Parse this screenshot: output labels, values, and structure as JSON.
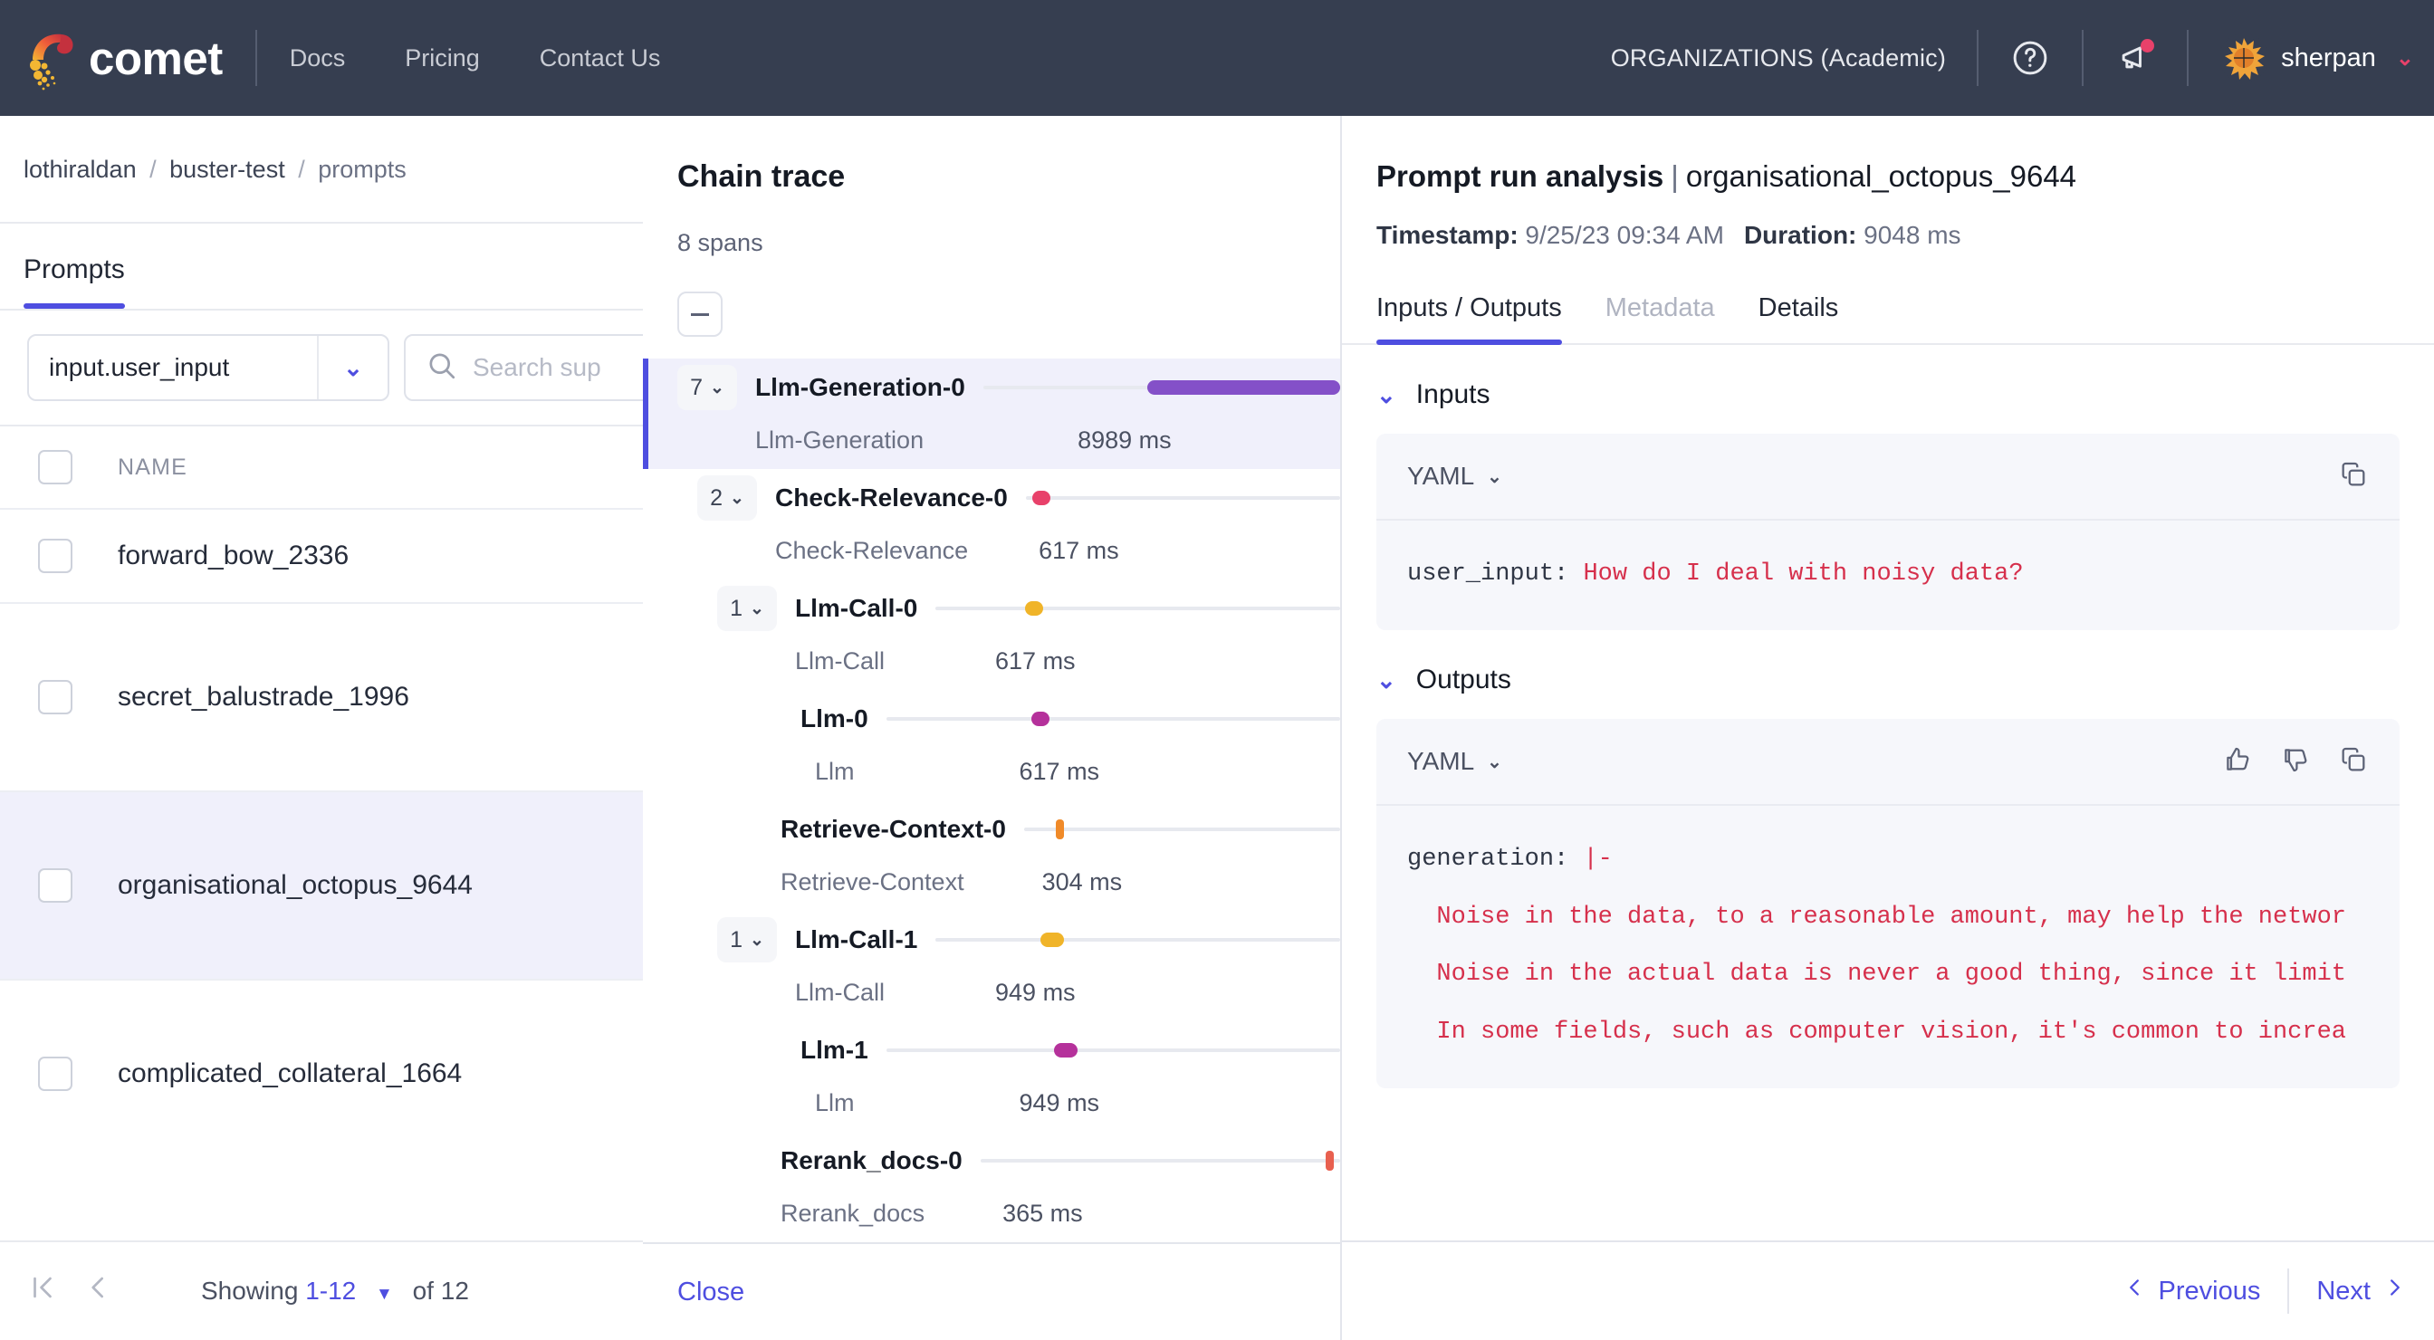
{
  "topnav": {
    "brand": "comet",
    "links": [
      {
        "label": "Docs"
      },
      {
        "label": "Pricing"
      },
      {
        "label": "Contact Us"
      }
    ],
    "organizations": "ORGANIZATIONS (Academic)",
    "help_icon": "question-circle-icon",
    "announcements_icon": "megaphone-icon",
    "username": "sherpan",
    "user_caret": "⌄",
    "colors": {
      "bar": "#363E50",
      "accent_pink": "#e8416a"
    }
  },
  "left_page": {
    "breadcrumb": {
      "workspace": "lothiraldan",
      "project": "buster-test",
      "section": "prompts",
      "separator": "/"
    },
    "tabs": [
      {
        "label": "Prompts",
        "active": true
      }
    ],
    "filter": {
      "select_value": "input.user_input",
      "select_caret": "⌄",
      "search_placeholder": "Search sup"
    },
    "table": {
      "columns": [
        "NAME"
      ],
      "rows": [
        {
          "name": "forward_bow_2336",
          "selected": false,
          "clipped": true
        },
        {
          "name": "secret_balustrade_1996",
          "selected": false
        },
        {
          "name": "organisational_octopus_9644",
          "selected": true
        },
        {
          "name": "complicated_collateral_1664",
          "selected": false
        }
      ]
    },
    "pagination": {
      "first_icon": "first-page-icon",
      "prev_icon": "chevron-left-icon",
      "showing_label": "Showing",
      "range": "1-12",
      "of_label": "of 12"
    }
  },
  "chain_trace": {
    "title": "Chain trace",
    "span_count": "8 spans",
    "collapse_all_icon": "minus-icon",
    "close_label": "Close",
    "spans": [
      {
        "badge": "7",
        "name": "Llm-Generation-0",
        "type": "Llm-Generation",
        "duration": "8989 ms",
        "color": "#8450c8",
        "bar_start_pct": 46,
        "bar_width_pct": 54,
        "active": true,
        "indent": 0,
        "shape": "bar"
      },
      {
        "badge": "2",
        "name": "Check-Relevance-0",
        "type": "Check-Relevance",
        "duration": "617 ms",
        "color": "#e8416a",
        "bar_start_pct": 46,
        "bar_width_pct": 3,
        "active": false,
        "indent": 1,
        "shape": "dot"
      },
      {
        "badge": "1",
        "name": "Llm-Call-0",
        "type": "Llm-Call",
        "duration": "617 ms",
        "color": "#f0b429",
        "bar_start_pct": 46,
        "bar_width_pct": 3,
        "active": false,
        "indent": 2,
        "shape": "dot"
      },
      {
        "badge": "",
        "name": "Llm-0",
        "type": "Llm",
        "duration": "617 ms",
        "color": "#b5319b",
        "bar_start_pct": 46,
        "bar_width_pct": 3,
        "active": false,
        "indent": 3,
        "shape": "dot"
      },
      {
        "badge": "",
        "name": "Retrieve-Context-0",
        "type": "Retrieve-Context",
        "duration": "304 ms",
        "color": "#f08a29",
        "bar_start_pct": 47,
        "bar_width_pct": 1.4,
        "active": false,
        "indent": 2,
        "shape": "tick"
      },
      {
        "badge": "1",
        "name": "Llm-Call-1",
        "type": "Llm-Call",
        "duration": "949 ms",
        "color": "#f0b429",
        "bar_start_pct": 46,
        "bar_width_pct": 4,
        "active": false,
        "indent": 2,
        "shape": "dot"
      },
      {
        "badge": "",
        "name": "Llm-1",
        "type": "Llm",
        "duration": "949 ms",
        "color": "#b5319b",
        "bar_start_pct": 46,
        "bar_width_pct": 4,
        "active": false,
        "indent": 3,
        "shape": "dot"
      },
      {
        "badge": "",
        "name": "Rerank_docs-0",
        "type": "Rerank_docs",
        "duration": "365 ms",
        "color": "#e8604f",
        "bar_start_pct": 94,
        "bar_width_pct": 1.4,
        "active": false,
        "indent": 2,
        "shape": "tick"
      }
    ]
  },
  "analysis": {
    "title_prefix": "Prompt run analysis",
    "title_sep": "|",
    "run_name": "organisational_octopus_9644",
    "timestamp_label": "Timestamp:",
    "timestamp_value": "9/25/23 09:34 AM",
    "duration_label": "Duration:",
    "duration_value": "9048 ms",
    "tabs": [
      {
        "label": "Inputs / Outputs",
        "active": true,
        "muted": false
      },
      {
        "label": "Metadata",
        "active": false,
        "muted": true
      },
      {
        "label": "Details",
        "active": false,
        "muted": false
      }
    ],
    "inputs": {
      "section_label": "Inputs",
      "chevron": "⌄",
      "format": "YAML",
      "format_caret": "⌄",
      "copy_icon": "copy-icon",
      "code_key": "user_input: ",
      "code_value": "How do I deal with noisy data?"
    },
    "outputs": {
      "section_label": "Outputs",
      "chevron": "⌄",
      "format": "YAML",
      "format_caret": "⌄",
      "thumbs_up_icon": "thumbs-up-icon",
      "thumbs_down_icon": "thumbs-down-icon",
      "copy_icon": "copy-icon",
      "code_key": "generation: ",
      "code_block_marker": "|-",
      "lines": [
        "Noise in the data, to a reasonable amount, may help the networ",
        "Noise in the actual data is never a good thing, since it limit",
        "In some fields, such as computer vision, it's common to increa"
      ]
    },
    "footer": {
      "previous_label": "Previous",
      "next_label": "Next",
      "prev_icon": "chevron-left-icon",
      "next_icon": "chevron-right-icon"
    }
  }
}
